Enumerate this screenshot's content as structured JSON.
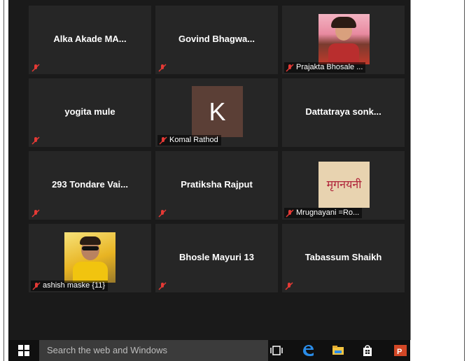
{
  "participants": [
    {
      "name": "Alka Akade MA...",
      "label": "",
      "muted": true,
      "avatar": ""
    },
    {
      "name": "Govind  Bhagwa...",
      "label": "",
      "muted": true,
      "avatar": ""
    },
    {
      "name": "",
      "label": "Prajakta Bhosale ...",
      "muted": true,
      "avatar": "photo-girl"
    },
    {
      "name": "yogita mule",
      "label": "",
      "muted": true,
      "avatar": ""
    },
    {
      "name": "",
      "label": "Komal Rathod",
      "muted": true,
      "avatar": "letter",
      "avatar_letter": "K"
    },
    {
      "name": "Dattatraya  sonk...",
      "label": "",
      "muted": false,
      "avatar": ""
    },
    {
      "name": "293  Tondare Vai...",
      "label": "",
      "muted": true,
      "avatar": ""
    },
    {
      "name": "Pratiksha Rajput",
      "label": "",
      "muted": true,
      "avatar": ""
    },
    {
      "name": "",
      "label": "Mrugnayani =Ro...",
      "muted": true,
      "avatar": "calligraphy",
      "avatar_text": "मृगनयनी"
    },
    {
      "name": "",
      "label": "ashish maske {11}",
      "muted": true,
      "avatar": "photo-man"
    },
    {
      "name": "Bhosle Mayuri 13",
      "label": "",
      "muted": true,
      "avatar": ""
    },
    {
      "name": "Tabassum Shaikh",
      "label": "",
      "muted": true,
      "avatar": ""
    }
  ],
  "taskbar": {
    "search_placeholder": "Search the web and Windows",
    "icons": [
      "windows-start-icon",
      "task-view-icon",
      "edge-icon",
      "file-explorer-icon",
      "store-icon",
      "powerpoint-icon"
    ]
  },
  "colors": {
    "tile": "#262626",
    "background": "#1a1a1a",
    "muted_mic": "#e53935",
    "taskbar": "#101010",
    "search": "#3b3b3b",
    "avatar_k": "#5b3f36"
  }
}
